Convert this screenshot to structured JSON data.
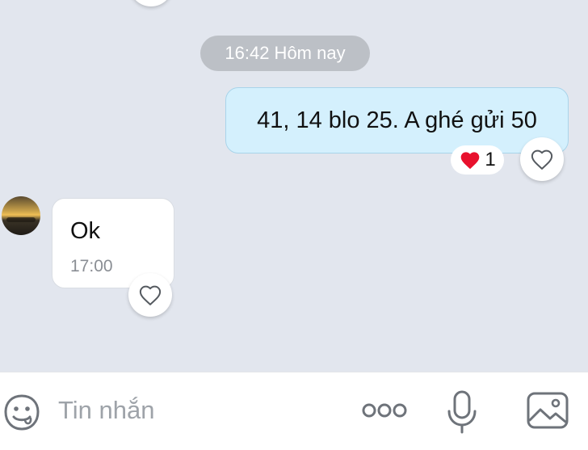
{
  "chat": {
    "timestamp_chip": "16:42 Hôm nay",
    "outgoing": {
      "text": "41, 14 blo 25. A ghé gửi 50",
      "reaction_count": "1",
      "reaction_icon": "red-heart",
      "reaction_color": "#e8112d"
    },
    "incoming": {
      "text": "Ok",
      "time": "17:00"
    },
    "colors": {
      "background": "#e2e6ee",
      "outgoing_bubble": "#d4f0fd",
      "incoming_bubble": "#ffffff"
    }
  },
  "composer": {
    "placeholder": "Tin nhắn",
    "icons": [
      "sticker-icon",
      "more-icon",
      "microphone-icon",
      "image-icon"
    ]
  }
}
